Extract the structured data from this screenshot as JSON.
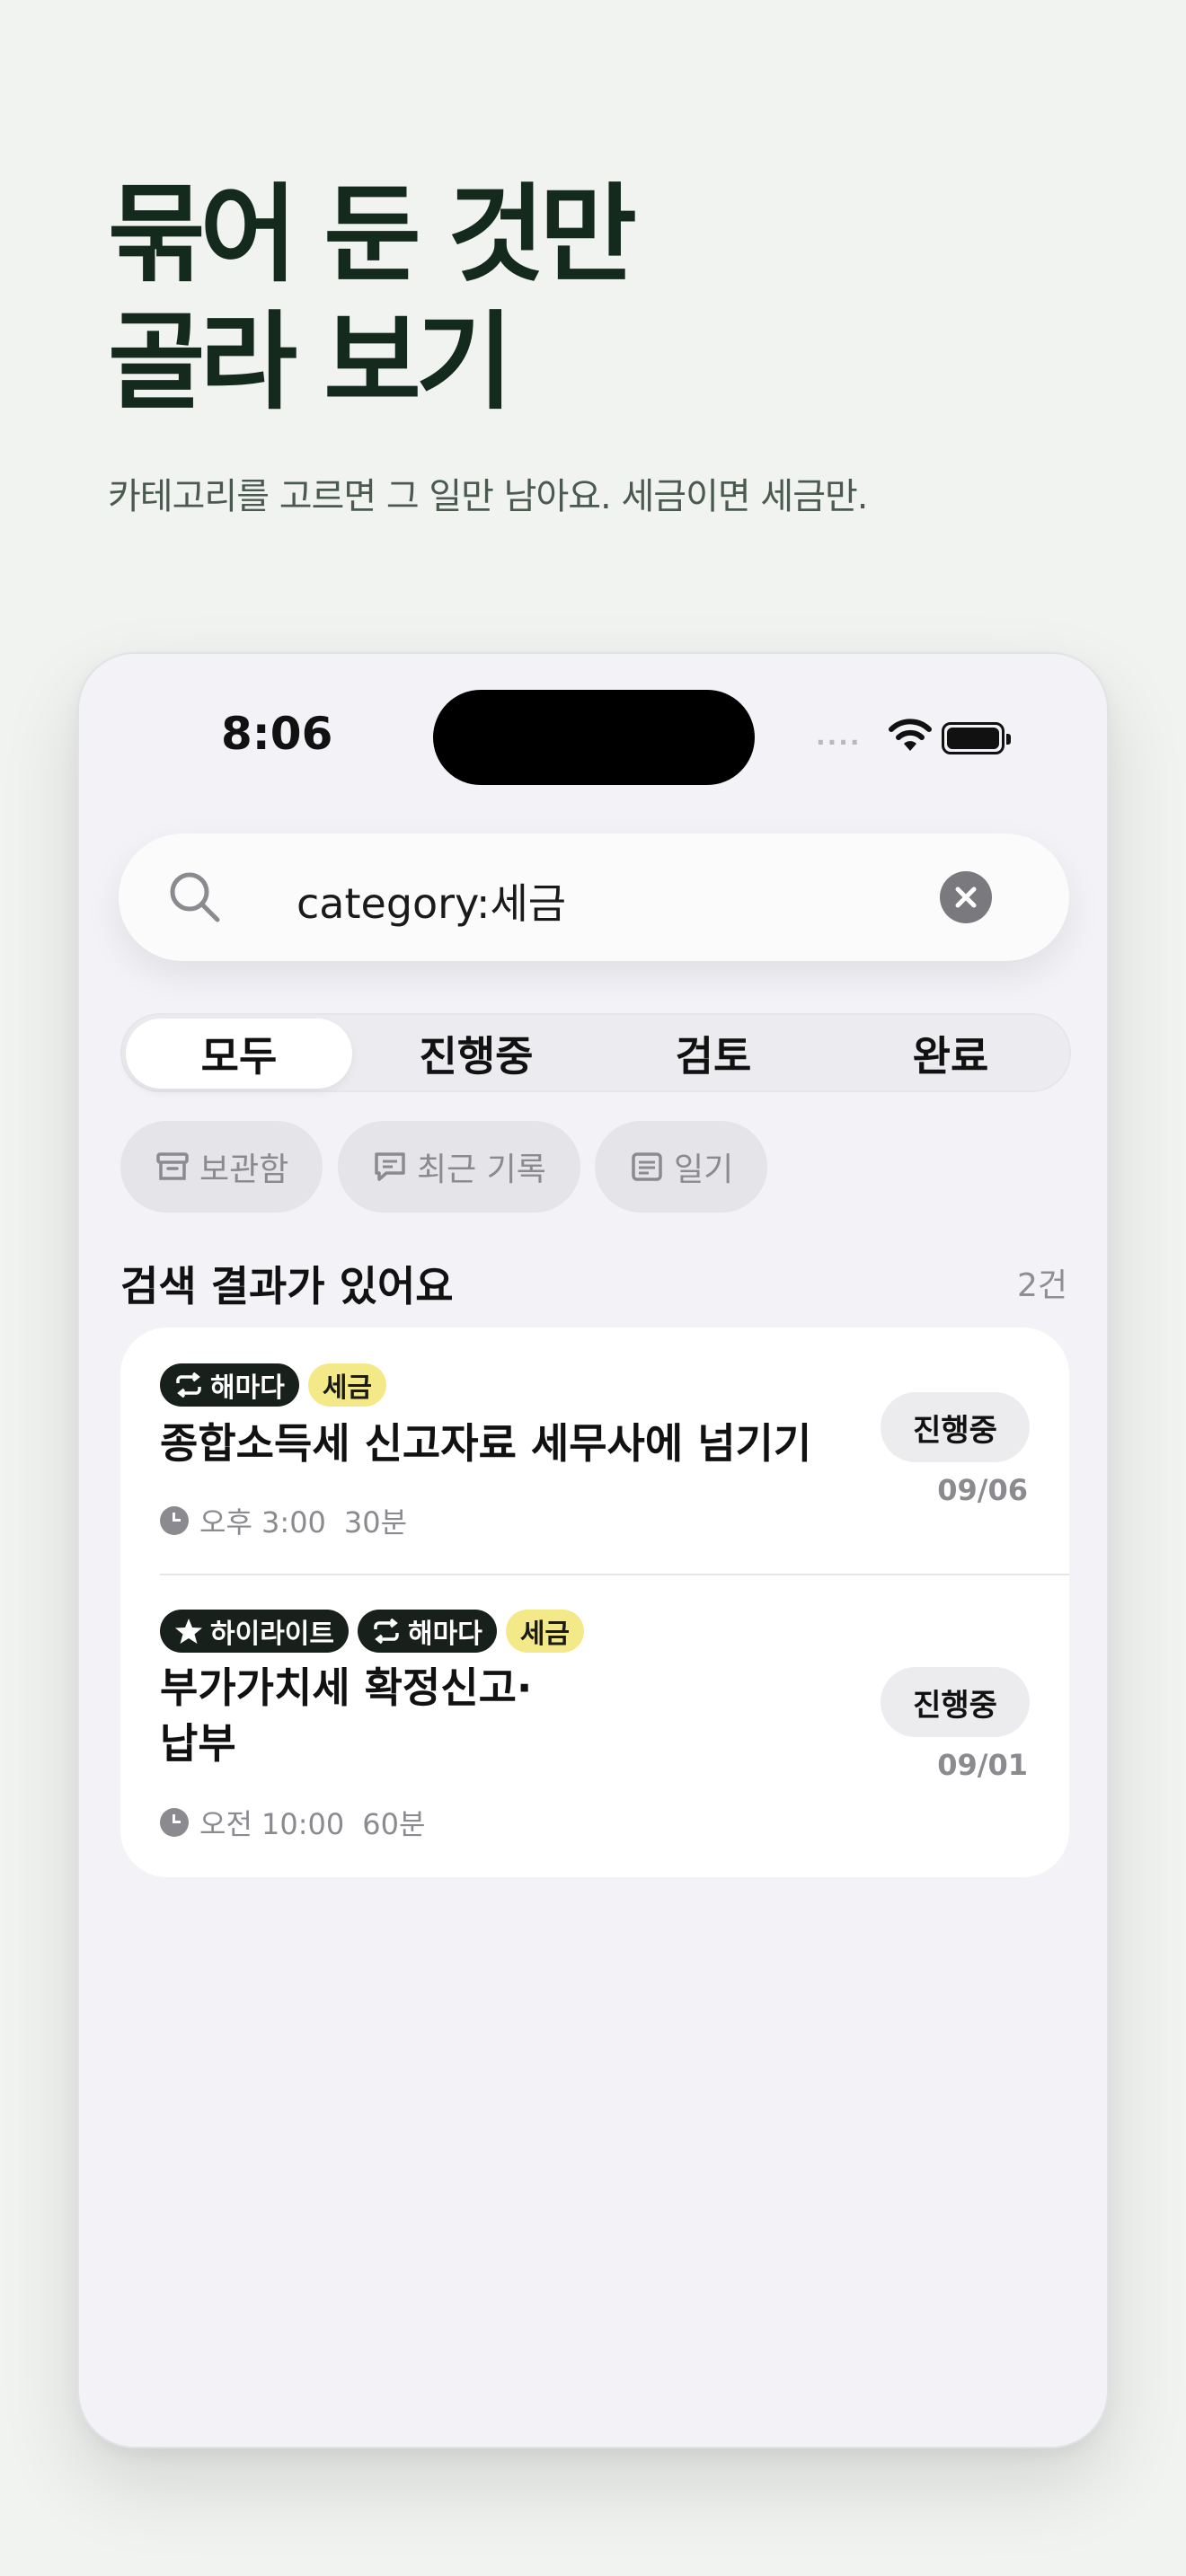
{
  "hero": {
    "line1": "묶어 둔 것만",
    "line2": "골라 보기",
    "subtitle": "카테고리를 고르면 그 일만 남아요. 세금이면 세금만."
  },
  "status_bar": {
    "time": "8:06",
    "signal": "····"
  },
  "search": {
    "query": "category:세금",
    "clear_icon": "close-icon",
    "icon": "search-icon"
  },
  "segments": [
    {
      "label": "모두",
      "active": true
    },
    {
      "label": "진행중",
      "active": false
    },
    {
      "label": "검토",
      "active": false
    },
    {
      "label": "완료",
      "active": false
    }
  ],
  "chips": [
    {
      "label": "보관함",
      "icon": "archive-icon"
    },
    {
      "label": "최근 기록",
      "icon": "chat-icon"
    },
    {
      "label": "일기",
      "icon": "journal-icon"
    }
  ],
  "results": {
    "title": "검색 결과가 있어요",
    "count": "2건",
    "items": [
      {
        "tags": [
          {
            "label": "해마다",
            "style": "dark",
            "icon": "repeat-icon"
          },
          {
            "label": "세금",
            "style": "yellow"
          }
        ],
        "title_lines": [
          "종합소득세 신고자료 세무사에 넘기기"
        ],
        "time": "오후 3:00",
        "duration": "30분",
        "status": "진행중",
        "date": "09/06"
      },
      {
        "tags": [
          {
            "label": "하이라이트",
            "style": "dark",
            "icon": "star-icon"
          },
          {
            "label": "해마다",
            "style": "dark",
            "icon": "repeat-icon"
          },
          {
            "label": "세금",
            "style": "yellow"
          }
        ],
        "title_lines": [
          "부가가치세 확정신고·",
          "납부"
        ],
        "time": "오전 10:00",
        "duration": "60분",
        "status": "진행중",
        "date": "09/01"
      }
    ]
  },
  "colors": {
    "page_bg": "#f1f3f1",
    "headline": "#132a1d",
    "tag_dark": "#17201b",
    "tag_yellow": "#f4e989"
  }
}
